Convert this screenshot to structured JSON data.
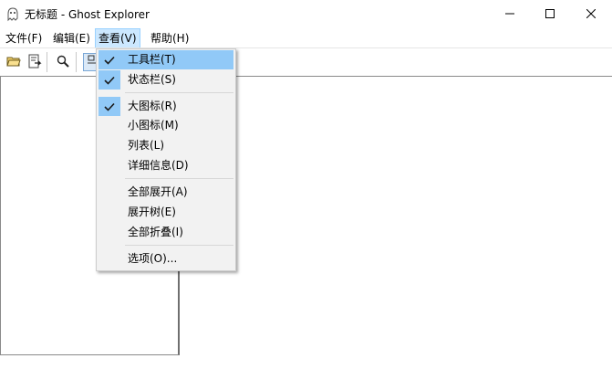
{
  "window": {
    "title": "无标题 - Ghost Explorer",
    "app_icon": "ghost-app-icon"
  },
  "window_controls": {
    "minimize_icon": "minimize-icon",
    "maximize_icon": "maximize-icon",
    "close_icon": "close-icon"
  },
  "menubar": {
    "items": [
      {
        "label": "文件(F)"
      },
      {
        "label": "编辑(E)"
      },
      {
        "label": "查看(V)",
        "active": true
      },
      {
        "label": "帮助(H)"
      }
    ]
  },
  "toolbar": {
    "buttons": [
      {
        "icon": "open-folder-icon"
      },
      {
        "icon": "extract-icon"
      },
      {
        "icon": "search-icon"
      },
      {
        "icon": "view-toggle-icon",
        "pressed": true
      }
    ]
  },
  "view_menu": {
    "items": [
      {
        "label": "工具栏(T)",
        "checked": true,
        "highlighted": true
      },
      {
        "label": "状态栏(S)",
        "checked": true
      },
      {
        "label": "大图标(R)",
        "checked": true
      },
      {
        "label": "小图标(M)",
        "checked": false
      },
      {
        "label": "列表(L)",
        "checked": false
      },
      {
        "label": "详细信息(D)",
        "checked": false
      },
      {
        "label": "全部展开(A)",
        "checked": false
      },
      {
        "label": "展开树(E)",
        "checked": false
      },
      {
        "label": "全部折叠(I)",
        "checked": false
      },
      {
        "label": "选项(O)...",
        "checked": false
      }
    ],
    "check_icon": "checkmark-icon"
  },
  "colors": {
    "menu_highlight": "#91c9f7",
    "menubar_active": "#cce8ff",
    "menu_background": "#f2f2f2"
  }
}
